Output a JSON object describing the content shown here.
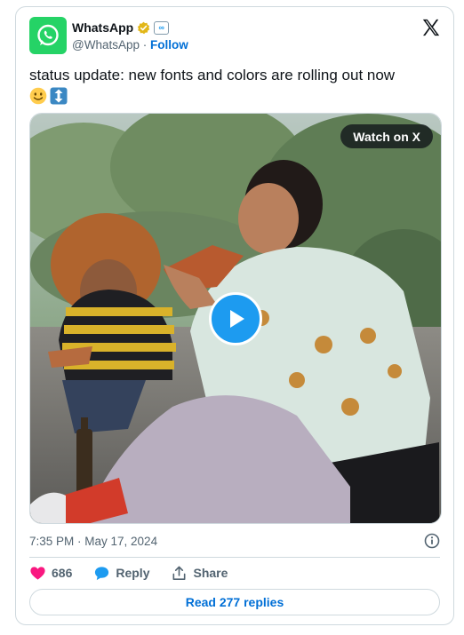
{
  "account": {
    "name": "WhatsApp",
    "handle": "@WhatsApp",
    "separator": "·",
    "follow_label": "Follow"
  },
  "tweet": {
    "text": "status update: new fonts and colors are rolling out now",
    "emojis": [
      "slightly-smiling-face-emoji",
      "up-down-arrow-emoji"
    ]
  },
  "media": {
    "watch_label": "Watch on X"
  },
  "timestamp": "7:35 PM · May 17, 2024",
  "actions": {
    "likes": "686",
    "reply_label": "Reply",
    "share_label": "Share"
  },
  "read_replies_label": "Read 277 replies",
  "colors": {
    "whatsapp_green": "#25d366",
    "link_blue": "#006fd6",
    "heart_red": "#f91880",
    "play_blue": "#1d9bf0"
  }
}
